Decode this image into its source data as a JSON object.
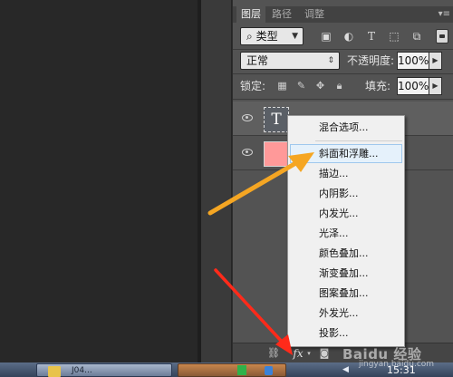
{
  "layers_panel": {
    "tabs": [
      {
        "label": "图层",
        "active": true
      },
      {
        "label": "路径",
        "active": false
      },
      {
        "label": "调整",
        "active": false
      }
    ],
    "filter": {
      "search_glyph": "⌕",
      "kind_label": "类型"
    },
    "blend_mode": "正常",
    "opacity": {
      "label": "不透明度:",
      "value": "100%"
    },
    "lock": {
      "label": "锁定:"
    },
    "fill": {
      "label": "填充:",
      "value": "100%"
    },
    "layers": [
      {
        "type": "text",
        "thumb_glyph": "T",
        "selected": true
      },
      {
        "type": "color-fill",
        "thumb_color": "#ff9999",
        "selected": false
      }
    ],
    "fx_label": "fx"
  },
  "context_menu": {
    "items": [
      {
        "label": "混合选项...",
        "hover": false
      },
      {
        "label": "斜面和浮雕...",
        "hover": true
      },
      {
        "label": "描边...",
        "hover": false
      },
      {
        "label": "内阴影...",
        "hover": false
      },
      {
        "label": "内发光...",
        "hover": false
      },
      {
        "label": "光泽...",
        "hover": false
      },
      {
        "label": "颜色叠加...",
        "hover": false
      },
      {
        "label": "渐变叠加...",
        "hover": false
      },
      {
        "label": "图案叠加...",
        "hover": false
      },
      {
        "label": "外发光...",
        "hover": false
      },
      {
        "label": "投影...",
        "hover": false
      }
    ]
  },
  "taskbar": {
    "button_label": "J04...",
    "clock": "15:31"
  },
  "watermark": {
    "brand": "Baidu 经验",
    "sub": "jingyan.baidu.com"
  },
  "annotation_colors": {
    "yellow": "#f5a623",
    "red": "#ff2a1a"
  }
}
